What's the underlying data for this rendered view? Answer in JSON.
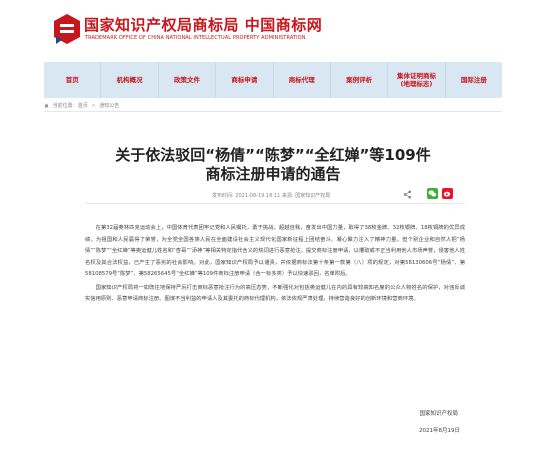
{
  "header": {
    "site_title": "国家知识产权局商标局 中国商标网",
    "site_subtitle": "TRADEMARK OFFICE OF CHINA NATIONAL INTELLECTUAL PROPERTY ADMINISTRATION",
    "brand_color": "#c8161d"
  },
  "nav": {
    "items": [
      {
        "label": "首页"
      },
      {
        "label": "机构概况"
      },
      {
        "label": "政策文件"
      },
      {
        "label": "商标申请"
      },
      {
        "label": "商标代理"
      },
      {
        "label": "案例评析"
      },
      {
        "label": "集体证明商标\n(地理标志)"
      },
      {
        "label": "国际注册"
      }
    ],
    "background": "#d9e7f3"
  },
  "breadcrumb": {
    "prefix": "当前位置:",
    "home": "首页",
    "sep": ">",
    "current": "通知公告"
  },
  "article": {
    "title_line1": "关于依法驳回“杨倩”“陈梦”“全红婵”等109件",
    "title_line2": "商标注册申请的通告",
    "meta": "发布时间: 2021-08-19 18:11    来源: 国家知识产权局",
    "paragraphs": [
      "在第32届奥林匹克运动会上，中国体育代表团牢记党和人民嘱托，勇于挑战，超越自我，奋发出中国力量，取得了38枚金牌、32枚银牌、18枚铜牌的优异成绩，为祖国和人民赢得了荣誉，为全党全国各族人民在全面建设社会主义现代化国家新征程上团结奋斗、凝心聚力注入了精神力量。但个别企业和自然人把“杨倩”“陈梦”“全红婵”等奥运健儿姓名和“杏哥”“添神”等相关特定指代含义的热词进行恶意抢注，提交商标注册申请，以攫取或不正当利用他人市场声誉，侵害他人姓名权及其合法权益，已产生了恶劣的社会影响。对此，国家知识产权局予以谴责，并依据商标法第十条第一款第（八）项的规定，对第58130606号“杨倩”、第58108579号“陈梦”、第58265645号“全红婵”等109件商标注册申请（含一标多类）予以快速驳回，名单附后。",
      "国家知识产权局将一如既往地保持严厉打击商标恶意抢注行为的高压态势，不断强化对包括奥运健儿在内的具有较高知名度的公众人物姓名的保护，对违反诚实信用原则、恶意申请商标注册、图谋不当利益的申请人及其委托的商标代理机构，依法依规严肃处理，持续营造良好的创新环境和营商环境。"
    ],
    "signature": "国家知识产权局",
    "date": "2021年8月19日"
  }
}
